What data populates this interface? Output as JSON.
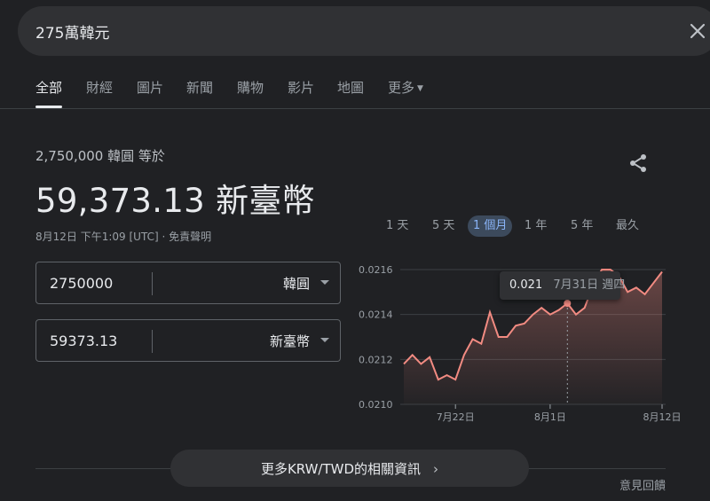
{
  "search": {
    "query": "275萬韓元"
  },
  "tabs": [
    {
      "label": "全部"
    },
    {
      "label": "財經"
    },
    {
      "label": "圖片"
    },
    {
      "label": "新聞"
    },
    {
      "label": "購物"
    },
    {
      "label": "影片"
    },
    {
      "label": "地圖"
    },
    {
      "label": "更多"
    }
  ],
  "converter": {
    "sub_label": "2,750,000 韓圓 等於",
    "result": "59,373.13 新臺幣",
    "timestamp": "8月12日 下午1:09 [UTC] · 免責聲明",
    "from": {
      "value": "2750000",
      "unit": "韓圓"
    },
    "to": {
      "value": "59373.13",
      "unit": "新臺幣"
    }
  },
  "ranges": [
    {
      "label": "1 天"
    },
    {
      "label": "5 天"
    },
    {
      "label": "1 個月",
      "active": true
    },
    {
      "label": "1 年"
    },
    {
      "label": "5 年"
    },
    {
      "label": "最久"
    }
  ],
  "tooltip": {
    "value": "0.021",
    "date": "7月31日 週四"
  },
  "chart_data": {
    "type": "area",
    "line_color": "#f28b82",
    "ylim": [
      0.021,
      0.0216
    ],
    "y_ticks": [
      "0.0216",
      "0.0214",
      "0.0212",
      "0.0210"
    ],
    "x_ticks": [
      "7月22日",
      "8月1日",
      "8月12日"
    ],
    "highlight_index": 19,
    "values": [
      0.02118,
      0.02122,
      0.02118,
      0.02121,
      0.02111,
      0.02113,
      0.02111,
      0.02122,
      0.02129,
      0.02127,
      0.02141,
      0.0213,
      0.0213,
      0.02135,
      0.02136,
      0.0214,
      0.02143,
      0.0214,
      0.02142,
      0.02145,
      0.0214,
      0.02143,
      0.02153,
      0.0216,
      0.0216,
      0.02157,
      0.0215,
      0.02152,
      0.02149,
      0.02154,
      0.02159
    ]
  },
  "footer": {
    "more_label": "更多KRW/TWD的相關資訊",
    "feedback": "意見回饋"
  }
}
